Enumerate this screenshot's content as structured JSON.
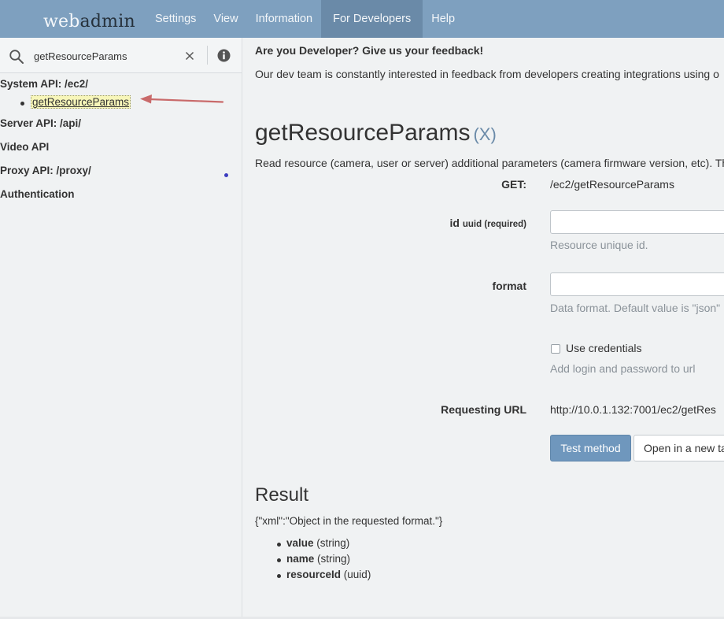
{
  "brand": {
    "part1": "web",
    "part2": "admin"
  },
  "nav": {
    "items": [
      {
        "label": "Settings"
      },
      {
        "label": "View"
      },
      {
        "label": "Information"
      },
      {
        "label": "For Developers",
        "active": true
      },
      {
        "label": "Help"
      }
    ]
  },
  "sidebar": {
    "search": {
      "value": "getResourceParams",
      "placeholder": ""
    },
    "groups": [
      {
        "label": "System API: /ec2/"
      },
      {
        "label": "Server API: /api/"
      },
      {
        "label": "Video API"
      },
      {
        "label": "Proxy API: /proxy/"
      },
      {
        "label": "Authentication"
      }
    ],
    "selected_method": "getResourceParams"
  },
  "main": {
    "feedback_title": "Are you Developer? Give us your feedback!",
    "feedback_text": "Our dev team is constantly interested in feedback from developers creating integrations using o",
    "method_name": "getResourceParams",
    "method_close": "(X)",
    "method_description": "Read resource (camera, user or server) additional parameters (camera firmware version, etc). Th",
    "get_label": "GET:",
    "get_value": "/ec2/getResourceParams",
    "id_label": "id",
    "id_type": "uuid (required)",
    "id_hint": "Resource unique id.",
    "id_value": "",
    "format_label": "format",
    "format_hint": "Data format. Default value is \"json\"",
    "format_value": "",
    "use_credentials_label": "Use credentials",
    "use_credentials_checked": false,
    "credentials_hint": "Add login and password to url",
    "requesting_url_label": "Requesting URL",
    "requesting_url_value": "http://10.0.1.132:7001/ec2/getRes",
    "test_button": "Test method",
    "open_tab_button": "Open in a new ta"
  },
  "result": {
    "title": "Result",
    "json": "{\"xml\":\"Object in the requested format.\"}",
    "fields": [
      {
        "name": "value",
        "type": "(string)"
      },
      {
        "name": "name",
        "type": "(string)"
      },
      {
        "name": "resourceId",
        "type": "(uuid)"
      }
    ]
  },
  "colors": {
    "navbar": "#7ea0bf",
    "nav_active": "#6a8aa8",
    "button_primary": "#6f97bd",
    "highlight": "#f7f6b9",
    "arrow": "#c96a6a"
  }
}
